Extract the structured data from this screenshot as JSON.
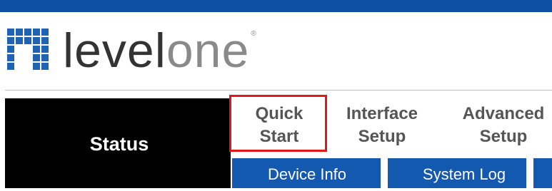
{
  "brand": {
    "logo_level": "level",
    "logo_one": "one",
    "logo_trademark": "®",
    "primary_color": "#0d4fa0",
    "logo_color": "#1f63b5"
  },
  "sidebar": {
    "status_label": "Status"
  },
  "tabs": [
    {
      "line1": "Quick",
      "line2": "Start",
      "highlighted": true
    },
    {
      "line1": "Interface",
      "line2": "Setup",
      "highlighted": false
    },
    {
      "line1": "Advanced",
      "line2": "Setup",
      "highlighted": false
    }
  ],
  "subnav": {
    "items": [
      {
        "label": "Device Info"
      },
      {
        "label": "System Log"
      }
    ]
  },
  "highlight_color": "#e01818"
}
